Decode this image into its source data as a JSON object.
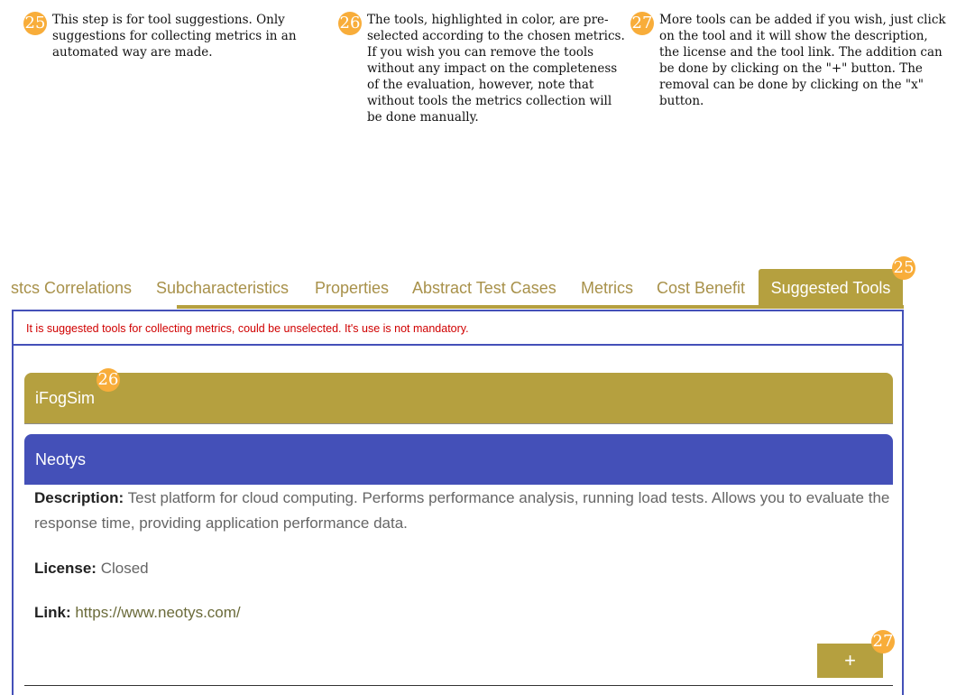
{
  "notes": [
    {
      "number": "25",
      "text": "This step is for tool suggestions. Only suggestions for collecting metrics in an automated way are made."
    },
    {
      "number": "26",
      "text": "The tools, highlighted in color, are pre-selected according to the chosen metrics. If you wish you can remove the tools without any impact on the completeness of the evaluation, however, note that without tools the metrics collection will be done manually."
    },
    {
      "number": "27",
      "text": "More tools can be added if you wish, just click on the tool and it will show the description, the license and the tool link. The addition can be done by clicking on the \"+\" button. The removal can be done by clicking on the \"x\" button."
    }
  ],
  "tabs": [
    {
      "label": "stcs Correlations",
      "active": false
    },
    {
      "label": "Subcharacteristics",
      "active": false
    },
    {
      "label": "Properties",
      "active": false
    },
    {
      "label": "Abstract Test Cases",
      "active": false
    },
    {
      "label": "Metrics",
      "active": false
    },
    {
      "label": "Cost Benefit",
      "active": false
    },
    {
      "label": "Suggested Tools",
      "active": true
    }
  ],
  "badges": {
    "tab": "25",
    "ifogsim": "26",
    "add": "27"
  },
  "notice": "It is suggested tools for collecting metrics, could be unselected. It's use is not mandatory.",
  "tools": [
    {
      "name": "iFogSim",
      "color": "#b5a03f",
      "expanded": false
    },
    {
      "name": "Neotys",
      "color": "#4450b8",
      "expanded": true,
      "description_label": "Description:",
      "description": "Test platform for cloud computing. Performs performance analysis, running load tests. Allows you to evaluate the response time, providing application performance data.",
      "license_label": "License:",
      "license": "Closed",
      "link_label": "Link:",
      "link": "https://www.neotys.com/"
    }
  ],
  "add_button": "+",
  "colors": {
    "accent_gold": "#b5a03f",
    "accent_blue": "#4450b8",
    "badge": "#f8ad3a",
    "notice_red": "#d00000"
  }
}
